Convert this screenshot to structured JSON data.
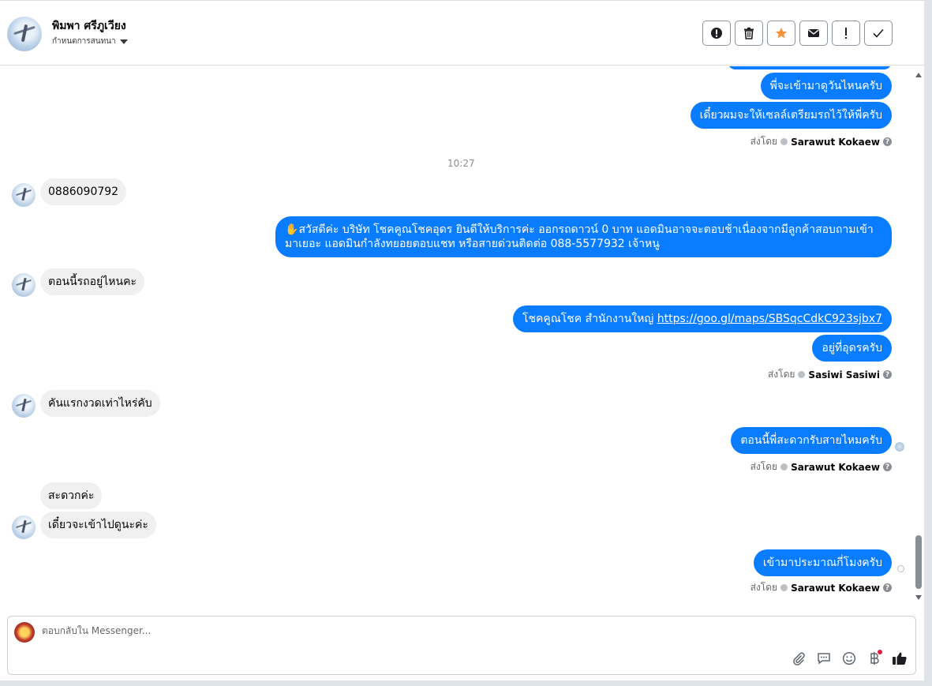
{
  "header": {
    "name": "พิมพา ศรีภูเวียง",
    "sub_label": "กำหนดการสนทนา",
    "toolbar": [
      {
        "name": "spam-button",
        "glyph": "!",
        "icon": "alert-circle-icon"
      },
      {
        "name": "delete-button",
        "glyph": "🗑",
        "icon": "trash-icon"
      },
      {
        "name": "star-button",
        "glyph": "★",
        "icon": "star-icon"
      },
      {
        "name": "mark-unread-button",
        "glyph": "✉",
        "icon": "envelope-icon"
      },
      {
        "name": "follow-up-button",
        "glyph": "!",
        "icon": "exclamation-icon"
      },
      {
        "name": "done-button",
        "glyph": "✓",
        "icon": "check-icon"
      }
    ],
    "star_color": "#f7923a"
  },
  "messages": {
    "m1": "พี่จะเข้ามาดูวันไหนครับ",
    "m2": "เดี๋ยวผมจะให้เซลล์เตรียมรถไว้ให้พี่ครับ",
    "sent_by_label": "ส่งโดย",
    "sender_1": "Sarawut Kokaew",
    "time": "10:27",
    "m3": "0886090792",
    "m4_emoji": "✋",
    "m4": "สวัสดีค่ะ บริษัท โชคคูณโชคอุดร ยินดีให้บริการค่ะ ออกรถดาวน์ 0 บาท แอดมินอาจจะตอบช้าเนื่องจากมีลูกค้าสอบถามเข้ามาเยอะ แอดมินกำลังทยอยตอบแชท หรือสายด่วนติดต่อ 088-5577932 เจ้าหนู",
    "m5": "ตอนนี้รถอยู่ไหนคะ",
    "m6_text": "โชคคูณโชค สำนักงานใหญ่ ",
    "m6_link": "https://goo.gl/maps/SBSqcCdkC923sjbx7",
    "m7": "อยู่ที่อุดรครับ",
    "sender_2": "Sasiwi Sasiwi",
    "m8": "คันแรกงวดเท่าไหร่คับ",
    "m9": "ตอนนี้พี่สะดวกรับสายไหมครับ",
    "sender_3": "Sarawut Kokaew",
    "m10": "สะดวกค่ะ",
    "m11": "เดี๋ยวจะเข้าไปดูนะค่ะ",
    "m12": "เข้ามาประมาณกี่โมงครับ",
    "sender_4": "Sarawut Kokaew",
    "help": "?"
  },
  "composer": {
    "placeholder": "ตอบกลับใน Messenger...",
    "icons": [
      "paperclip-icon",
      "saved-reply-icon",
      "emoji-icon",
      "baht-payment-icon",
      "thumbs-up-icon"
    ]
  },
  "colors": {
    "outgoing": "#0a7cff",
    "incoming": "#f0f0f0"
  }
}
